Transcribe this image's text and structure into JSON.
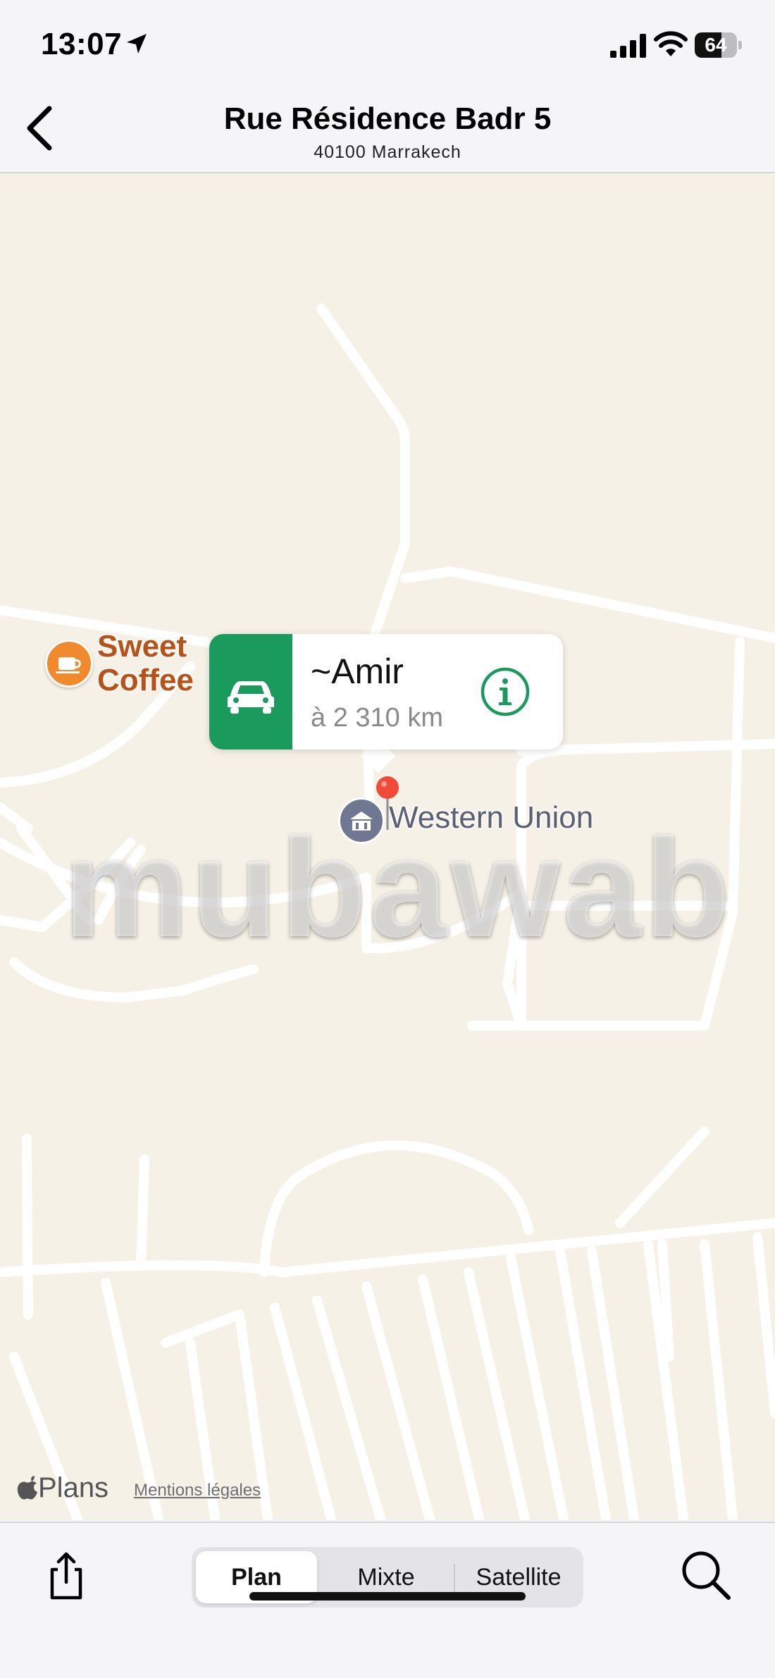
{
  "status_bar": {
    "time": "13:07",
    "battery": "64",
    "battery_level": 0.64,
    "icons": [
      "location-arrow-icon",
      "cellular-signal-icon",
      "wifi-icon",
      "battery-icon"
    ]
  },
  "header": {
    "title": "Rue Résidence Badr 5",
    "subtitle": "40100 Marrakech",
    "back_icon": "chevron-left-icon"
  },
  "map": {
    "pois": {
      "coffee": {
        "name": "Sweet Coffee",
        "line1": "Sweet",
        "line2": "Coffee",
        "icon": "coffee-cup-icon",
        "color": "#f08a2c"
      },
      "bank": {
        "name": "Western Union",
        "icon": "bank-icon",
        "color": "#707891"
      }
    },
    "callout": {
      "name": "~Amir",
      "distance": "à 2 310 km",
      "transport_icon": "car-icon",
      "info_icon": "info-icon",
      "accent": "#1b9a5d"
    },
    "watermark": "mubawab",
    "attribution": "Plans",
    "legal": "Mentions légales"
  },
  "toolbar": {
    "share_icon": "share-icon",
    "search_icon": "search-icon",
    "segments": [
      "Plan",
      "Mixte",
      "Satellite"
    ],
    "selected_segment": "Plan"
  }
}
